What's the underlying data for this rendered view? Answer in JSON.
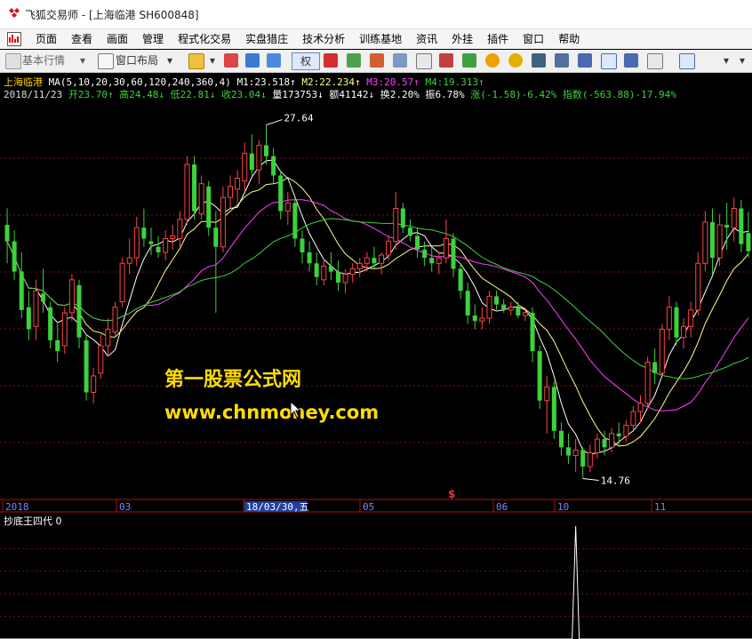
{
  "window": {
    "title": "飞狐交易师 - [上海临港 SH600848]"
  },
  "menu": {
    "items": [
      "页面",
      "查看",
      "画面",
      "管理",
      "程式化交易",
      "实盘猎庄",
      "技术分析",
      "训练基地",
      "资讯",
      "外挂",
      "插件",
      "窗口",
      "帮助"
    ]
  },
  "toolbar": {
    "basic_quotes": "基本行情",
    "window_layout": "窗口布局",
    "rights": "权"
  },
  "header": {
    "stock_name": "上海临港",
    "ma_label": "MA(5,10,20,30,60,120,240,360,4)",
    "m1": "M1:23.518↑",
    "m2": "M2:22.234↑",
    "m3": "M3:20.57↑",
    "m4": "M4:19.313↑",
    "date": "2018/11/23",
    "open": "开23.70↑",
    "high": "高24.48↓",
    "low": "低22.81↓",
    "close": "收23.04↓",
    "volume": "量173753↓",
    "amount": "额41142↓",
    "turnover": "换2.20%",
    "amplitude": "振6.78%",
    "change": "涨(-1.58)-6.42%",
    "index": "指数(-563.88)-17.94%"
  },
  "annotations": {
    "high_price": "27.64",
    "low_price": "14.76",
    "s_marker": "$"
  },
  "timeline": {
    "labels": [
      "2018",
      "03",
      "18/03/30,五",
      "05",
      "06",
      "10",
      "11"
    ]
  },
  "indicator": {
    "label": "抄底王四代 0"
  },
  "watermark": {
    "line1": "第一股票公式网",
    "line2": "www.chnmoney.com"
  },
  "colors": {
    "up": "#ff4444",
    "down": "#3cd23c",
    "ma5": "#ffffff",
    "ma10": "#ffff80",
    "ma20": "#ff40ff",
    "ma30": "#40d040",
    "grid": "#7a1010"
  },
  "chart_data": {
    "type": "candlestick",
    "ohlc": [
      [
        24.0,
        24.6,
        22.6,
        23.4
      ],
      [
        23.4,
        23.8,
        22.0,
        22.3
      ],
      [
        22.3,
        23.0,
        20.6,
        20.9
      ],
      [
        21.0,
        21.6,
        19.8,
        20.2
      ],
      [
        20.3,
        22.0,
        19.8,
        21.6
      ],
      [
        21.5,
        22.4,
        20.8,
        21.2
      ],
      [
        21.0,
        21.2,
        19.5,
        19.8
      ],
      [
        19.8,
        20.4,
        19.0,
        19.4
      ],
      [
        19.6,
        21.0,
        19.3,
        20.8
      ],
      [
        20.8,
        22.2,
        20.5,
        22.0
      ],
      [
        21.8,
        22.0,
        19.5,
        19.9
      ],
      [
        19.8,
        20.0,
        17.6,
        17.9
      ],
      [
        17.9,
        18.8,
        17.5,
        18.5
      ],
      [
        18.6,
        20.0,
        18.4,
        19.6
      ],
      [
        19.6,
        20.6,
        19.2,
        20.2
      ],
      [
        20.1,
        21.2,
        19.9,
        21.0
      ],
      [
        21.2,
        22.8,
        21.0,
        22.6
      ],
      [
        22.6,
        23.5,
        22.2,
        22.8
      ],
      [
        22.8,
        24.3,
        22.5,
        23.9
      ],
      [
        23.9,
        24.6,
        23.2,
        23.5
      ],
      [
        23.4,
        23.9,
        22.9,
        23.3
      ],
      [
        23.2,
        23.6,
        22.8,
        23.0
      ],
      [
        23.0,
        23.8,
        22.7,
        23.5
      ],
      [
        23.5,
        24.0,
        23.1,
        23.6
      ],
      [
        23.5,
        24.5,
        23.2,
        24.2
      ],
      [
        24.2,
        26.5,
        24.0,
        26.2
      ],
      [
        26.2,
        26.5,
        24.2,
        24.5
      ],
      [
        24.4,
        25.8,
        24.2,
        25.5
      ],
      [
        25.4,
        25.6,
        23.6,
        23.9
      ],
      [
        23.9,
        24.5,
        20.8,
        23.2
      ],
      [
        23.2,
        25.4,
        23.0,
        25.0
      ],
      [
        25.0,
        25.8,
        24.6,
        25.4
      ],
      [
        25.3,
        26.0,
        24.8,
        25.7
      ],
      [
        25.6,
        27.0,
        25.2,
        26.6
      ],
      [
        26.6,
        27.3,
        25.8,
        26.0
      ],
      [
        26.0,
        27.1,
        25.5,
        26.9
      ],
      [
        26.9,
        27.64,
        26.2,
        26.5
      ],
      [
        26.5,
        26.8,
        25.5,
        25.8
      ],
      [
        25.8,
        26.0,
        24.2,
        24.5
      ],
      [
        24.5,
        25.2,
        24.0,
        24.8
      ],
      [
        24.8,
        25.0,
        23.2,
        23.5
      ],
      [
        23.5,
        23.8,
        22.6,
        23.0
      ],
      [
        23.0,
        23.4,
        22.3,
        22.6
      ],
      [
        22.6,
        23.0,
        21.8,
        22.1
      ],
      [
        22.0,
        22.8,
        21.8,
        22.5
      ],
      [
        22.5,
        23.0,
        22.0,
        22.3
      ],
      [
        22.3,
        22.7,
        21.6,
        21.9
      ],
      [
        21.9,
        22.4,
        21.5,
        22.2
      ],
      [
        22.2,
        22.6,
        21.9,
        22.4
      ],
      [
        22.4,
        22.8,
        22.1,
        22.6
      ],
      [
        22.6,
        23.0,
        22.3,
        22.8
      ],
      [
        22.8,
        23.2,
        22.4,
        22.6
      ],
      [
        22.6,
        23.0,
        22.2,
        22.9
      ],
      [
        22.9,
        23.6,
        22.7,
        23.4
      ],
      [
        23.4,
        25.2,
        23.1,
        24.6
      ],
      [
        24.6,
        24.8,
        23.7,
        23.9
      ],
      [
        23.9,
        24.2,
        23.4,
        23.6
      ],
      [
        23.6,
        23.9,
        22.8,
        23.1
      ],
      [
        23.1,
        23.4,
        22.5,
        22.8
      ],
      [
        22.8,
        23.2,
        22.3,
        22.6
      ],
      [
        22.6,
        23.0,
        22.2,
        22.8
      ],
      [
        22.8,
        24.2,
        22.6,
        23.5
      ],
      [
        23.5,
        23.7,
        22.1,
        22.4
      ],
      [
        22.4,
        22.6,
        21.3,
        21.6
      ],
      [
        21.6,
        21.9,
        20.4,
        20.7
      ],
      [
        20.7,
        21.1,
        20.2,
        20.5
      ],
      [
        20.5,
        21.0,
        20.2,
        20.6
      ],
      [
        20.6,
        21.6,
        20.4,
        21.4
      ],
      [
        21.4,
        21.6,
        20.9,
        21.1
      ],
      [
        21.1,
        21.3,
        20.8,
        20.9
      ],
      [
        20.9,
        21.2,
        20.7,
        21.0
      ],
      [
        21.0,
        21.2,
        20.6,
        20.7
      ],
      [
        20.7,
        21.0,
        20.5,
        20.8
      ],
      [
        20.8,
        21.0,
        19.0,
        19.4
      ],
      [
        19.4,
        19.6,
        17.3,
        17.6
      ],
      [
        17.6,
        18.5,
        16.4,
        18.1
      ],
      [
        18.1,
        18.3,
        16.2,
        16.5
      ],
      [
        16.5,
        16.8,
        15.6,
        15.9
      ],
      [
        15.9,
        16.4,
        15.3,
        15.6
      ],
      [
        15.6,
        16.2,
        15.0,
        15.8
      ],
      [
        15.8,
        15.9,
        14.76,
        15.2
      ],
      [
        15.2,
        16.0,
        15.0,
        15.7
      ],
      [
        15.7,
        16.4,
        15.5,
        16.2
      ],
      [
        16.2,
        16.5,
        15.6,
        15.9
      ],
      [
        15.9,
        16.6,
        15.7,
        16.4
      ],
      [
        16.4,
        16.8,
        16.0,
        16.3
      ],
      [
        16.3,
        16.9,
        16.1,
        16.7
      ],
      [
        16.7,
        17.4,
        16.5,
        17.2
      ],
      [
        17.2,
        17.8,
        16.8,
        17.5
      ],
      [
        17.5,
        19.2,
        17.3,
        19.0
      ],
      [
        19.0,
        19.5,
        18.2,
        18.6
      ],
      [
        18.6,
        20.4,
        18.5,
        20.2
      ],
      [
        20.2,
        21.4,
        19.8,
        21.0
      ],
      [
        21.0,
        21.2,
        19.6,
        19.9
      ],
      [
        19.9,
        20.6,
        19.5,
        20.3
      ],
      [
        20.3,
        21.2,
        19.9,
        20.9
      ],
      [
        20.9,
        23.0,
        20.7,
        22.6
      ],
      [
        22.6,
        24.5,
        22.3,
        24.1
      ],
      [
        24.1,
        24.6,
        22.2,
        22.8
      ],
      [
        22.8,
        24.4,
        22.5,
        24.0
      ],
      [
        24.0,
        24.8,
        23.1,
        23.9
      ],
      [
        23.9,
        25.0,
        23.4,
        24.6
      ],
      [
        24.6,
        24.9,
        23.0,
        23.3
      ],
      [
        23.7,
        24.48,
        22.81,
        23.04
      ]
    ],
    "price_range": [
      14.0,
      28.5
    ],
    "indicator_signal_index": 79
  }
}
